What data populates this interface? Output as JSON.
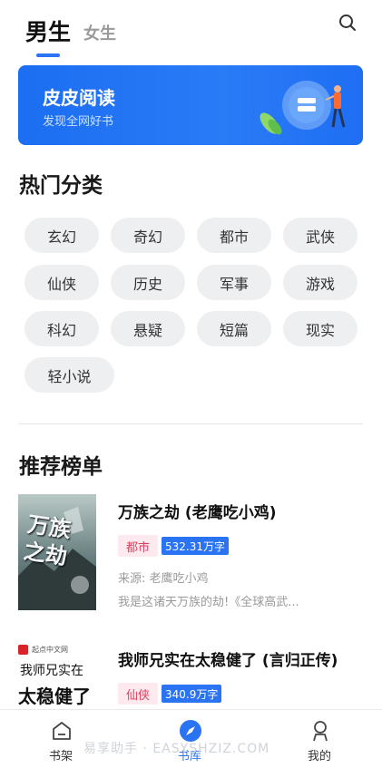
{
  "header": {
    "tabs": [
      {
        "label": "男生",
        "active": true
      },
      {
        "label": "女生",
        "active": false
      }
    ],
    "search_icon": "search-icon"
  },
  "banner": {
    "title": "皮皮阅读",
    "subtitle": "发现全网好书"
  },
  "categories": {
    "title": "热门分类",
    "items": [
      "玄幻",
      "奇幻",
      "都市",
      "武侠",
      "仙侠",
      "历史",
      "军事",
      "游戏",
      "科幻",
      "悬疑",
      "短篇",
      "现实",
      "轻小说"
    ]
  },
  "ranking": {
    "title": "推荐榜单",
    "books": [
      {
        "title": "万族之劫 (老鹰吃小鸡)",
        "genre": "都市",
        "words": "532.31万字",
        "source": "来源: 老鹰吃小鸡",
        "desc": "我是这诸天万族的劫!《全球高武...",
        "cover_text": "万族之劫"
      },
      {
        "title": "我师兄实在太稳健了 (言归正传)",
        "genre": "仙侠",
        "words": "340.9万字",
        "cover_badge": "起点中文网",
        "cover_line1": "我师兄实在",
        "cover_line2": "太稳健了"
      }
    ]
  },
  "bottom_nav": [
    {
      "label": "书架",
      "icon": "bookshelf-icon",
      "active": false
    },
    {
      "label": "书库",
      "icon": "compass-icon",
      "active": true
    },
    {
      "label": "我的",
      "icon": "user-icon",
      "active": false
    }
  ],
  "watermark": "易享助手 · EASYSHZIZ.COM",
  "colors": {
    "accent": "#2a74f4",
    "genre_tag_bg": "#fde9ee",
    "genre_tag_text": "#e0405f",
    "chip_bg": "#eeeff1"
  }
}
